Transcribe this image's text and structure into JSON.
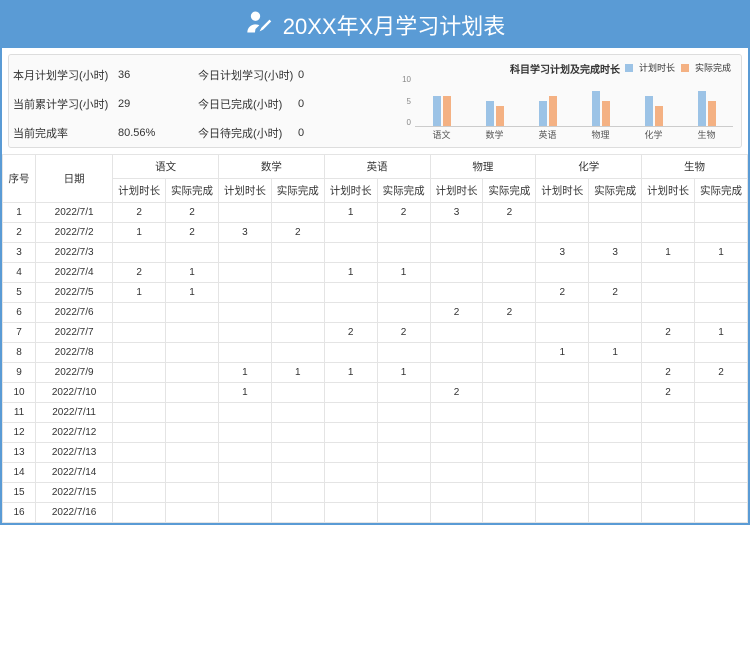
{
  "title": "20XX年X月学习计划表",
  "summary": {
    "rows": [
      {
        "label": "本月计划学习(小时)",
        "value": "36",
        "extra": "",
        "label2": "今日计划学习(小时)",
        "value2": "0"
      },
      {
        "label": "当前累计学习(小时)",
        "value": "29",
        "extra": "",
        "label2": "今日已完成(小时)",
        "value2": "0"
      },
      {
        "label": "当前完成率",
        "value": "80.56%",
        "extra": "",
        "label2": "今日待完成(小时)",
        "value2": "0"
      }
    ]
  },
  "chart_data": {
    "type": "bar",
    "title": "科目学习计划及完成时长",
    "ylabel": "",
    "ylim": [
      0,
      10
    ],
    "yticks": [
      10,
      5,
      0
    ],
    "categories": [
      "语文",
      "数学",
      "英语",
      "物理",
      "化学",
      "生物"
    ],
    "series": [
      {
        "name": "计划时长",
        "values": [
          6,
          5,
          5,
          7,
          6,
          7
        ],
        "color": "#9cc3e6"
      },
      {
        "name": "实际完成",
        "values": [
          6,
          4,
          6,
          5,
          4,
          5
        ],
        "color": "#f4b183"
      }
    ],
    "legend": [
      "计划时长",
      "实际完成"
    ]
  },
  "table": {
    "header": {
      "seq": "序号",
      "date": "日期"
    },
    "subjects": [
      "语文",
      "数学",
      "英语",
      "物理",
      "化学",
      "生物"
    ],
    "subcols": [
      "计划时长",
      "实际完成"
    ],
    "rows": [
      {
        "seq": 1,
        "date": "2022/7/1",
        "cells": [
          "2",
          "2",
          "",
          "",
          "1",
          "2",
          "3",
          "2",
          "",
          "",
          "",
          ""
        ]
      },
      {
        "seq": 2,
        "date": "2022/7/2",
        "cells": [
          "1",
          "2",
          "3",
          "2",
          "",
          "",
          "",
          "",
          "",
          "",
          "",
          ""
        ]
      },
      {
        "seq": 3,
        "date": "2022/7/3",
        "cells": [
          "",
          "",
          "",
          "",
          "",
          "",
          "",
          "",
          "3",
          "3",
          "1",
          "1"
        ]
      },
      {
        "seq": 4,
        "date": "2022/7/4",
        "cells": [
          "2",
          "1",
          "",
          "",
          "1",
          "1",
          "",
          "",
          "",
          "",
          "",
          ""
        ]
      },
      {
        "seq": 5,
        "date": "2022/7/5",
        "cells": [
          "1",
          "1",
          "",
          "",
          "",
          "",
          "",
          "",
          "2",
          "2",
          "",
          ""
        ]
      },
      {
        "seq": 6,
        "date": "2022/7/6",
        "cells": [
          "",
          "",
          "",
          "",
          "",
          "",
          "2",
          "2",
          "",
          "",
          "",
          ""
        ]
      },
      {
        "seq": 7,
        "date": "2022/7/7",
        "cells": [
          "",
          "",
          "",
          "",
          "2",
          "2",
          "",
          "",
          "",
          "",
          "2",
          "1"
        ]
      },
      {
        "seq": 8,
        "date": "2022/7/8",
        "cells": [
          "",
          "",
          "",
          "",
          "",
          "",
          "",
          "",
          "1",
          "1",
          "",
          ""
        ]
      },
      {
        "seq": 9,
        "date": "2022/7/9",
        "cells": [
          "",
          "",
          "1",
          "1",
          "1",
          "1",
          "",
          "",
          "",
          "",
          "2",
          "2"
        ]
      },
      {
        "seq": 10,
        "date": "2022/7/10",
        "cells": [
          "",
          "",
          "1",
          "",
          "",
          "",
          "2",
          "",
          "",
          "",
          "2",
          ""
        ]
      },
      {
        "seq": 11,
        "date": "2022/7/11",
        "cells": [
          "",
          "",
          "",
          "",
          "",
          "",
          "",
          "",
          "",
          "",
          "",
          ""
        ]
      },
      {
        "seq": 12,
        "date": "2022/7/12",
        "cells": [
          "",
          "",
          "",
          "",
          "",
          "",
          "",
          "",
          "",
          "",
          "",
          ""
        ]
      },
      {
        "seq": 13,
        "date": "2022/7/13",
        "cells": [
          "",
          "",
          "",
          "",
          "",
          "",
          "",
          "",
          "",
          "",
          "",
          ""
        ]
      },
      {
        "seq": 14,
        "date": "2022/7/14",
        "cells": [
          "",
          "",
          "",
          "",
          "",
          "",
          "",
          "",
          "",
          "",
          "",
          ""
        ]
      },
      {
        "seq": 15,
        "date": "2022/7/15",
        "cells": [
          "",
          "",
          "",
          "",
          "",
          "",
          "",
          "",
          "",
          "",
          "",
          ""
        ]
      },
      {
        "seq": 16,
        "date": "2022/7/16",
        "cells": [
          "",
          "",
          "",
          "",
          "",
          "",
          "",
          "",
          "",
          "",
          "",
          ""
        ]
      }
    ]
  }
}
